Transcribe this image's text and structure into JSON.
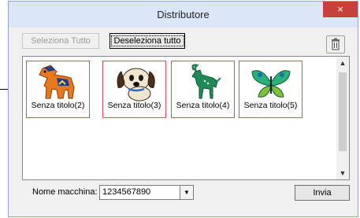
{
  "window": {
    "title": "Distributore",
    "close_glyph": "×"
  },
  "toolbar": {
    "select_all_label": "Seleziona Tutto",
    "deselect_all_label": "Deseleziona tutto",
    "trash_icon": "trash-icon"
  },
  "designs": [
    {
      "caption": "Senza titolo(2)",
      "icon": "horse-icon"
    },
    {
      "caption": "Senza titolo(3)",
      "icon": "dog-icon"
    },
    {
      "caption": "Senza titolo(4)",
      "icon": "ibex-icon"
    },
    {
      "caption": "Senza titolo(5)",
      "icon": "butterfly-icon"
    }
  ],
  "machine": {
    "label": "Nome macchina:",
    "value": "1234567890"
  },
  "send_label": "Invia",
  "colors": {
    "tile_border": "#e05050",
    "title_bar": "#dbe6f8",
    "close_button": "#c9403a"
  }
}
